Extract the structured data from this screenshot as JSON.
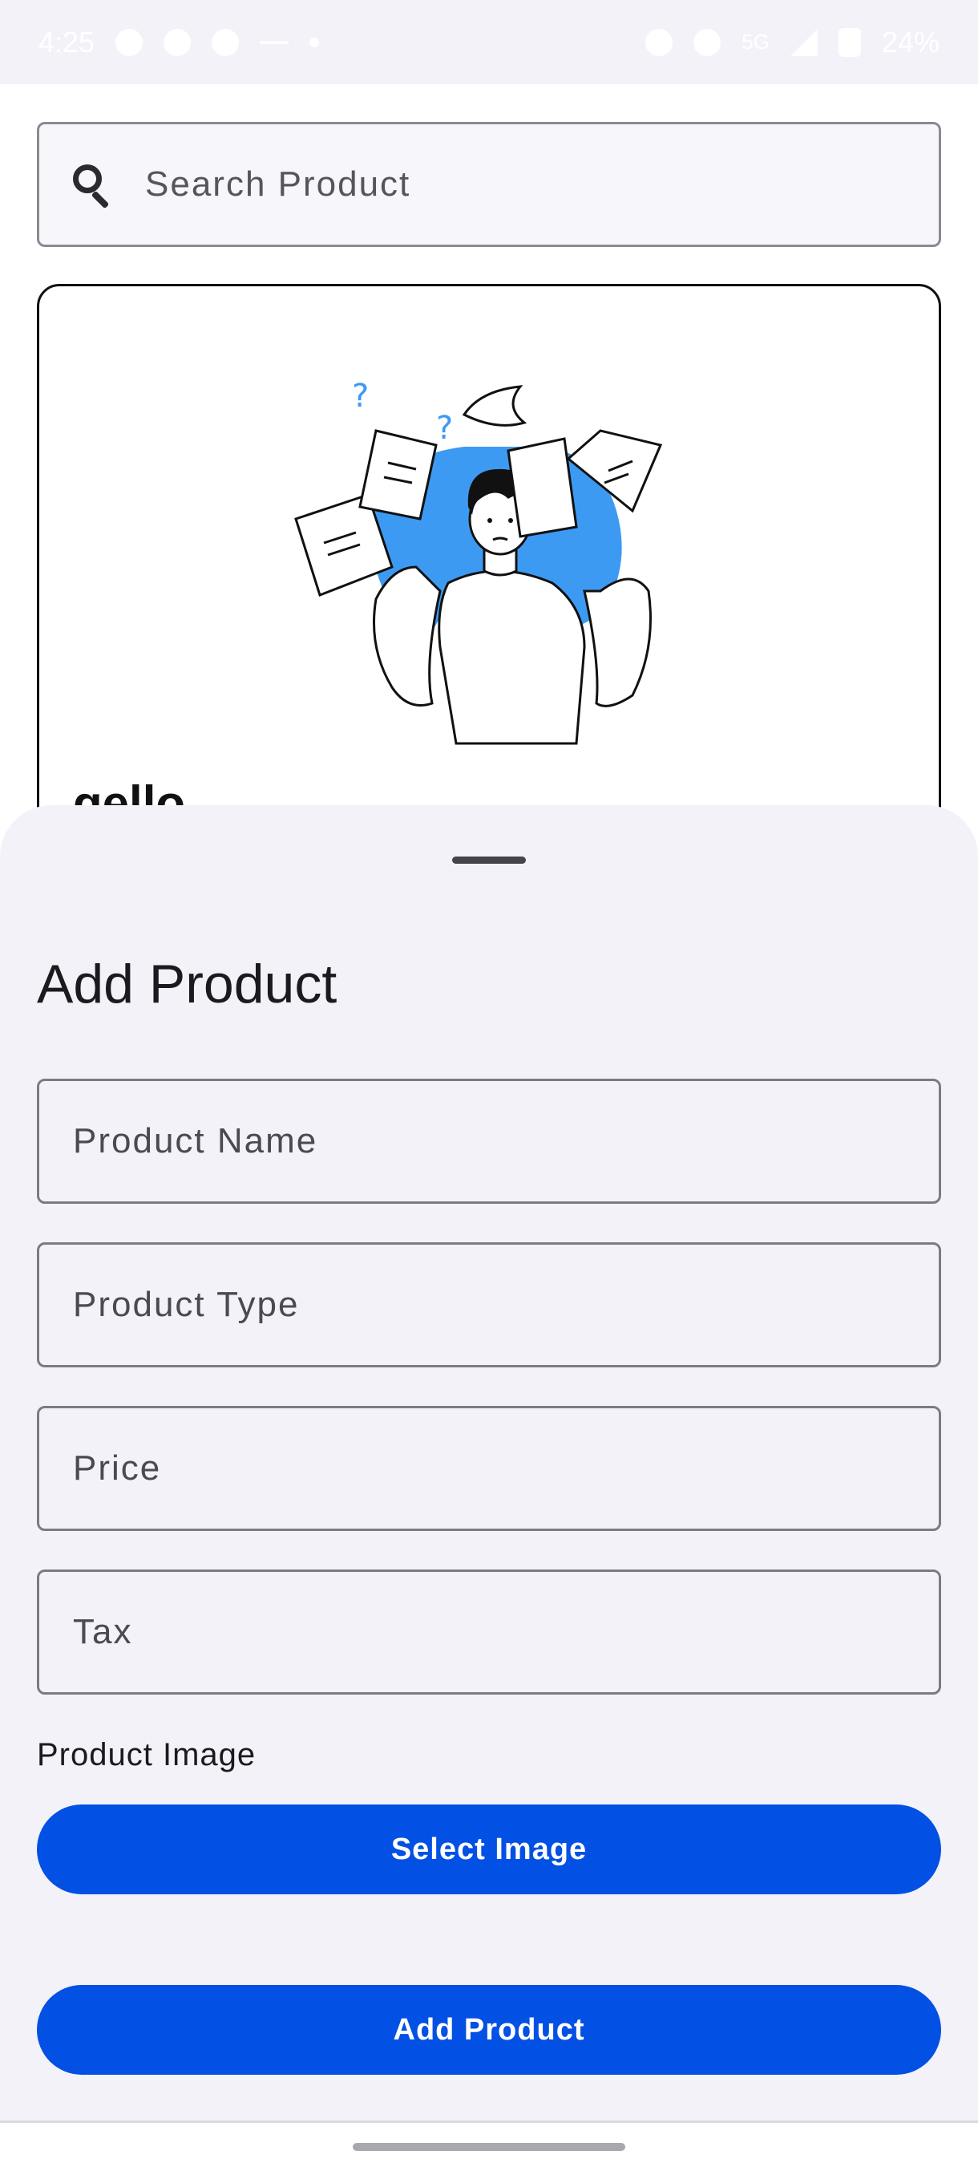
{
  "status_bar": {
    "time": "4:25",
    "battery": "24%",
    "network": "5G",
    "icons": [
      "snapchat-icon",
      "telegram-icon",
      "location-icon",
      "minus-icon",
      "dot-icon",
      "alarm-icon",
      "vibrate-off-icon",
      "signal-icon",
      "battery-icon"
    ]
  },
  "search": {
    "placeholder": "Search Product"
  },
  "product_card": {
    "name": "gello"
  },
  "sheet": {
    "title": "Add Product",
    "fields": {
      "product_name_placeholder": "Product Name",
      "product_type_placeholder": "Product Type",
      "price_placeholder": "Price",
      "tax_placeholder": "Tax"
    },
    "image_label": "Product Image",
    "select_image_label": "Select Image",
    "add_product_label": "Add Product"
  },
  "colors": {
    "accent": "#0250e4",
    "illustration_blue": "#3d9af2",
    "sheet_background": "#f3f2f8"
  }
}
